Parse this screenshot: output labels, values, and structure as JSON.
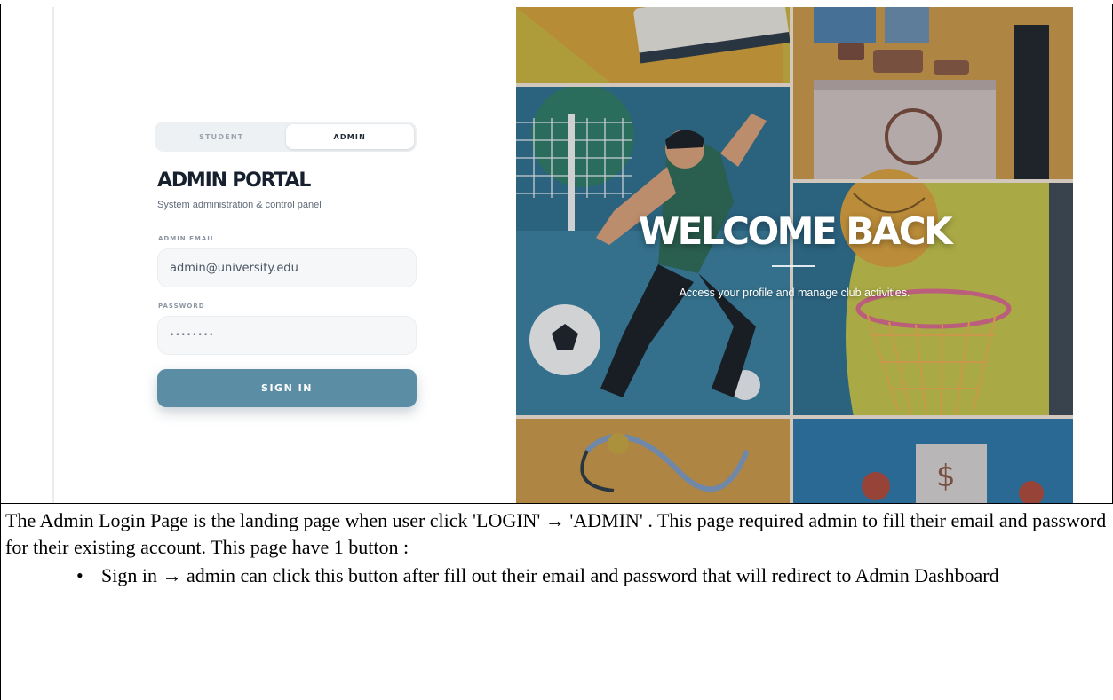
{
  "screenshot": {
    "tabs": [
      "STUDENT",
      "ADMIN"
    ],
    "active_tab": "ADMIN",
    "title": "ADMIN PORTAL",
    "subtitle": "System administration & control panel",
    "email_label": "ADMIN EMAIL",
    "email_value": "admin@university.edu",
    "password_label": "PASSWORD",
    "password_value": "••••••••",
    "sign_in_label": "SIGN IN",
    "welcome_title": "WELCOME BACK",
    "welcome_subtitle": "Access your profile and manage club activities."
  },
  "description": {
    "paragraph": "The Admin Login Page is the landing page when user click 'LOGIN' → 'ADMIN' . This page required admin to fill their email and password for their existing account. This page have 1 button :",
    "bullets": [
      "Sign in → admin can click this button after fill out their email and password that will redirect to Admin Dashboard"
    ],
    "bullet_symbol": "•"
  },
  "colors": {
    "button": "#5b8da5",
    "title": "#16202e"
  }
}
